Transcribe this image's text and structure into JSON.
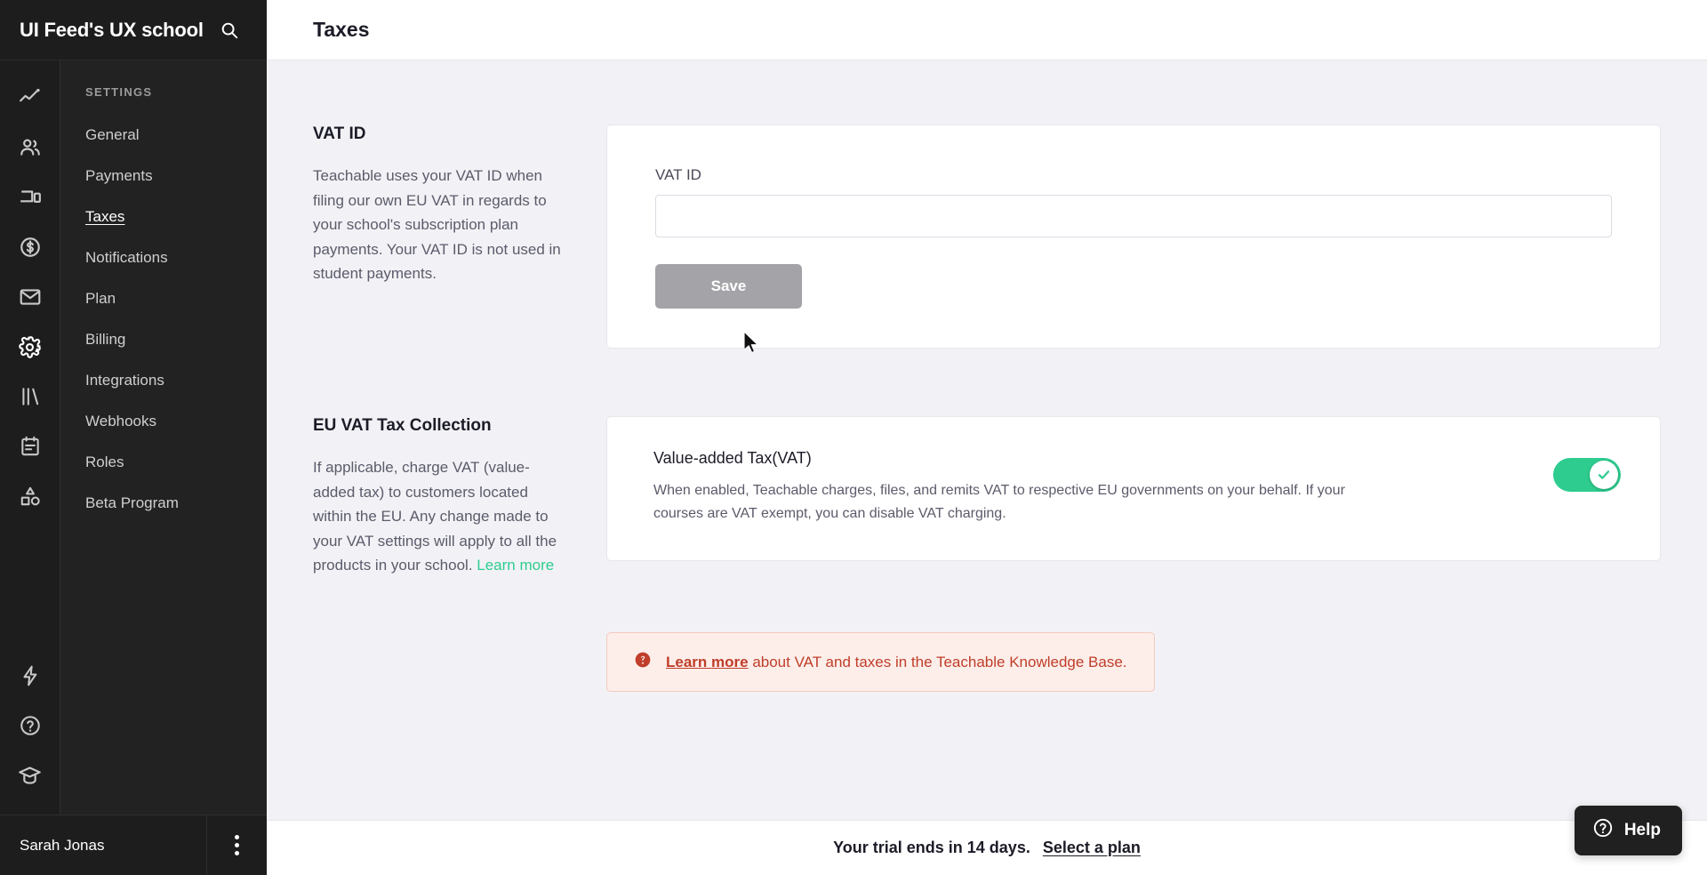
{
  "sidebar": {
    "brand": "UI Feed's UX school",
    "search_icon": "search-icon",
    "rail_icons": [
      {
        "name": "analytics-icon"
      },
      {
        "name": "users-icon"
      },
      {
        "name": "site-icon"
      },
      {
        "name": "sales-icon"
      },
      {
        "name": "email-icon"
      },
      {
        "name": "settings-icon"
      },
      {
        "name": "library-icon"
      },
      {
        "name": "calendar-icon"
      },
      {
        "name": "apps-icon"
      },
      {
        "name": "bolt-icon"
      },
      {
        "name": "help-circle-icon"
      },
      {
        "name": "graduation-cap-icon"
      }
    ],
    "section_heading": "SETTINGS",
    "items": [
      {
        "label": "General",
        "active": false
      },
      {
        "label": "Payments",
        "active": false
      },
      {
        "label": "Taxes",
        "active": true
      },
      {
        "label": "Notifications",
        "active": false
      },
      {
        "label": "Plan",
        "active": false
      },
      {
        "label": "Billing",
        "active": false
      },
      {
        "label": "Integrations",
        "active": false
      },
      {
        "label": "Webhooks",
        "active": false
      },
      {
        "label": "Roles",
        "active": false
      },
      {
        "label": "Beta Program",
        "active": false
      }
    ],
    "user": {
      "name": "Sarah Jonas",
      "menu_icon": "kebab-menu-icon"
    }
  },
  "header": {
    "title": "Taxes"
  },
  "vat_id_section": {
    "title": "VAT ID",
    "description": "Teachable uses your VAT ID when filing our own EU VAT in regards to your school's subscription plan payments. Your VAT ID is not used in student payments.",
    "field_label": "VAT ID",
    "field_value": "",
    "field_placeholder": "",
    "save_label": "Save"
  },
  "eu_vat_section": {
    "title": "EU VAT Tax Collection",
    "description": "If applicable, charge VAT (value-added tax) to customers located within the EU. Any change made to your VAT settings will apply to all the products in your school. ",
    "link_label": "Learn more",
    "card": {
      "title": "Value-added Tax(VAT)",
      "description": "When enabled, Teachable charges, files, and remits VAT to respective EU governments on your behalf. If your courses are VAT exempt, you can disable VAT charging.",
      "toggle_on": true,
      "toggle_icon": "check-icon"
    }
  },
  "alert": {
    "icon": "help-circle-filled-icon",
    "link_label": "Learn more",
    "text": " about VAT and taxes in the Teachable Knowledge Base."
  },
  "footer": {
    "trial_text": "Your trial ends in 14 days.",
    "link_label": "Select a plan"
  },
  "help_button": {
    "label": "Help",
    "icon": "question-circle-icon"
  },
  "colors": {
    "accent_green": "#2ecc8f",
    "sidebar_dark": "#1d1d1d",
    "nav_dark": "#222222",
    "alert_red": "#c03e2a",
    "alert_bg": "#fdeeea",
    "page_bg": "#f2f2f6"
  }
}
